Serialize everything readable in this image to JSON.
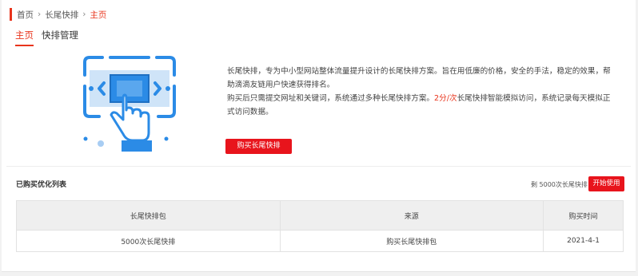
{
  "breadcrumb": {
    "items": [
      "首页",
      "长尾快排",
      "主页"
    ],
    "separator": "›"
  },
  "tabs": [
    {
      "label": "主页",
      "active": true
    },
    {
      "label": "快排管理",
      "active": false
    }
  ],
  "intro": {
    "line1": "长尾快排，专为中小型网站整体流量提升设计的长尾快排方案。旨在用低廉的价格，安全的手法，稳定的效果，帮助滴滴友链用户快速获得排名。",
    "line2_before": "购买后只需提交网址和关键词，系统通过多种长尾快排方案。",
    "price": "2分/次",
    "line2_after": "长尾快排智能模拟访问，系统记录每天模拟正式访问数据。"
  },
  "buy_button": "购买长尾快排",
  "list": {
    "title": "已购买优化列表",
    "remaining": "剩 5000次长尾快排",
    "start_button": "开始使用",
    "columns": [
      "长尾快排包",
      "来源",
      "购买时间"
    ],
    "rows": [
      [
        "5000次长尾快排",
        "购买长尾快排包",
        "2021-4-1"
      ]
    ]
  },
  "colors": {
    "accent": "#e8341c",
    "button": "#e8141c",
    "illustration": "#2b8be6"
  }
}
